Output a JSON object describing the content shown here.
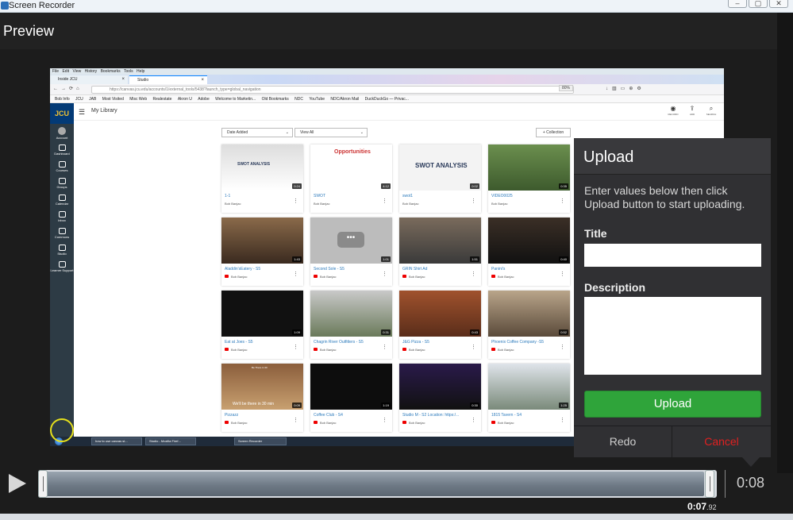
{
  "window": {
    "title": "Screen Recorder",
    "controls": [
      "–",
      "▢",
      "✕"
    ]
  },
  "preview": {
    "title": "Preview"
  },
  "browser": {
    "menu": [
      "File",
      "Edit",
      "View",
      "History",
      "Bookmarks",
      "Tools",
      "Help"
    ],
    "tabs": [
      {
        "label": "Inside JCU",
        "close": "×"
      },
      {
        "label": "Studio",
        "close": "×"
      }
    ],
    "url": "https://canvas.jcu.edu/accounts/1/external_tools/5438?launch_type=global_navigation",
    "zoom": "80%",
    "bookmarks": [
      "Bob Info",
      "JCU",
      "JAB",
      "Most Visited",
      "Misc Web",
      "Realestate",
      "Akron U",
      "Adobe",
      "Welcome to Marketin...",
      "Old Bookmarks",
      "NDC",
      "YouTube",
      "NDC/Akron Mail",
      "DuckDuckGo — Privac..."
    ]
  },
  "canvas": {
    "logo": "JCU",
    "nav": [
      {
        "label": "Account"
      },
      {
        "label": "Dashboard"
      },
      {
        "label": "Courses"
      },
      {
        "label": "Groups"
      },
      {
        "label": "Calendar"
      },
      {
        "label": "Inbox"
      },
      {
        "label": "Commons"
      },
      {
        "label": "Studio"
      },
      {
        "label": "Learner Support"
      }
    ]
  },
  "studio": {
    "title": "My Library",
    "hamburger": "☰",
    "top_icons": [
      {
        "glyph": "◉",
        "label": "RECORD"
      },
      {
        "glyph": "⇪",
        "label": "ADD"
      },
      {
        "glyph": "⌕",
        "label": "SEARCH"
      }
    ],
    "sort_select": "Date Added",
    "filter_select": "View All",
    "collection_button": "+ Collection",
    "videos": [
      {
        "title": "1-1",
        "owner": "Bob Banjac",
        "duration": "0:24",
        "yt": false
      },
      {
        "title": "SWOT",
        "owner": "Bob Banjac",
        "duration": "4:12",
        "yt": false
      },
      {
        "title": "swot1",
        "owner": "Bob Banjac",
        "duration": "0:02",
        "yt": false
      },
      {
        "title": "VIDEO0025",
        "owner": "Bob Banjac",
        "duration": "0:35",
        "yt": false
      },
      {
        "title": "Aladdin'sEatery - S5",
        "owner": "Bob Banjac",
        "duration": "1:43",
        "yt": true
      },
      {
        "title": "Second Sole - S5",
        "owner": "Bob Banjac",
        "duration": "1:01",
        "yt": true
      },
      {
        "title": "GRIN Shirt Ad",
        "owner": "Bob Banjac",
        "duration": "1:51",
        "yt": true
      },
      {
        "title": "Panini's",
        "owner": "Bob Banjac",
        "duration": "0:40",
        "yt": true
      },
      {
        "title": "Eat at Joes - S5",
        "owner": "Bob Banjac",
        "duration": "1:09",
        "yt": true
      },
      {
        "title": "Chagrin River Outfitters - S5",
        "owner": "Bob Banjac",
        "duration": "0:31",
        "yt": true
      },
      {
        "title": "J&G Pizza - S5",
        "owner": "Bob Banjac",
        "duration": "0:43",
        "yt": true
      },
      {
        "title": "Phoenix Coffee Company -S5",
        "owner": "Bob Banjac",
        "duration": "0:52",
        "yt": true
      },
      {
        "title": "Pizzazz",
        "owner": "Bob Banjac",
        "duration": "0:09",
        "yt": true
      },
      {
        "title": "Coffee Club - S4",
        "owner": "Bob Banjac",
        "duration": "1:19",
        "yt": true
      },
      {
        "title": "Studio M - S2 Location: https:/...",
        "owner": "Bob Banjac",
        "duration": "0:30",
        "yt": true
      },
      {
        "title": "1815 Tavern - S4",
        "owner": "Bob Banjac",
        "duration": "1:25",
        "yt": true
      }
    ],
    "thumb_text": {
      "swot_title": "SWOT ANALYSIS",
      "opportunities": "Opportunities",
      "pizzazz_top": "Be There in 30",
      "pizzazz_caption": "We'll be there in 30 min"
    }
  },
  "taskbar": {
    "items": [
      "how to use canvas st...",
      "Studio - Mozilla Firef...",
      "Screen Recorder"
    ]
  },
  "upload_panel": {
    "title": "Upload",
    "instructions": "Enter values below then click Upload button to start uploading.",
    "title_label": "Title",
    "title_value": "",
    "description_label": "Description",
    "description_value": "",
    "upload_button": "Upload",
    "redo_button": "Redo",
    "cancel_button": "Cancel"
  },
  "playback": {
    "total_time": "0:08",
    "current_time": "0:07",
    "current_time_fraction": ".92",
    "progress": 0.99
  },
  "colors": {
    "upload_green": "#2fa43a",
    "cancel_red": "#e02020",
    "panel_bg": "#303033"
  }
}
